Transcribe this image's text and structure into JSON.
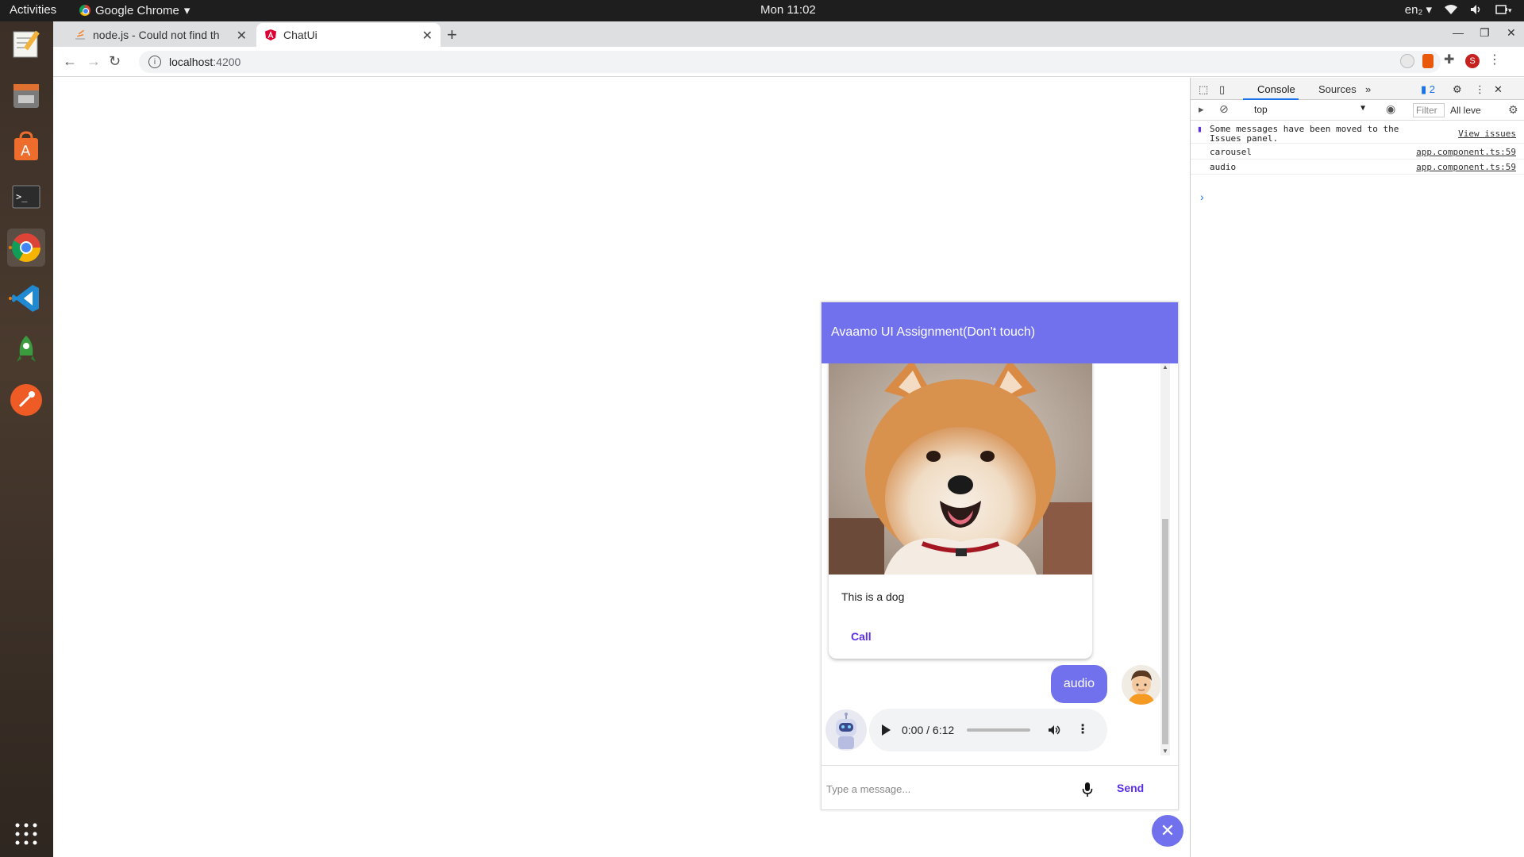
{
  "desktop": {
    "activities": "Activities",
    "app_name": "Google Chrome",
    "clock": "Mon 11:02",
    "lang": "en₂"
  },
  "browser": {
    "tabs": [
      {
        "title": "node.js - Could not find th"
      },
      {
        "title": "ChatUi"
      }
    ],
    "url_host": "localhost",
    "url_port": ":4200",
    "profile_initial": "S"
  },
  "chat": {
    "header_title": "Avaamo UI Assignment(Don't touch)",
    "card_caption": "This is a dog",
    "card_button": "Call",
    "user_message": "audio",
    "audio_time": "0:00 / 6:12",
    "input_placeholder": "Type a message...",
    "send_label": "Send"
  },
  "devtools": {
    "tabs": [
      "Console",
      "Sources"
    ],
    "issues_count": "2",
    "context": "top",
    "filter_placeholder": "Filter",
    "levels": "All leve",
    "messages": [
      {
        "text": "Some messages have been moved to the Issues panel.",
        "link": "View issues"
      },
      {
        "text": "carousel",
        "link": "app.component.ts:59"
      },
      {
        "text": "audio",
        "link": "app.component.ts:59"
      }
    ]
  },
  "colors": {
    "accent": "#7171ee",
    "link_purple": "#5b2ee8"
  }
}
